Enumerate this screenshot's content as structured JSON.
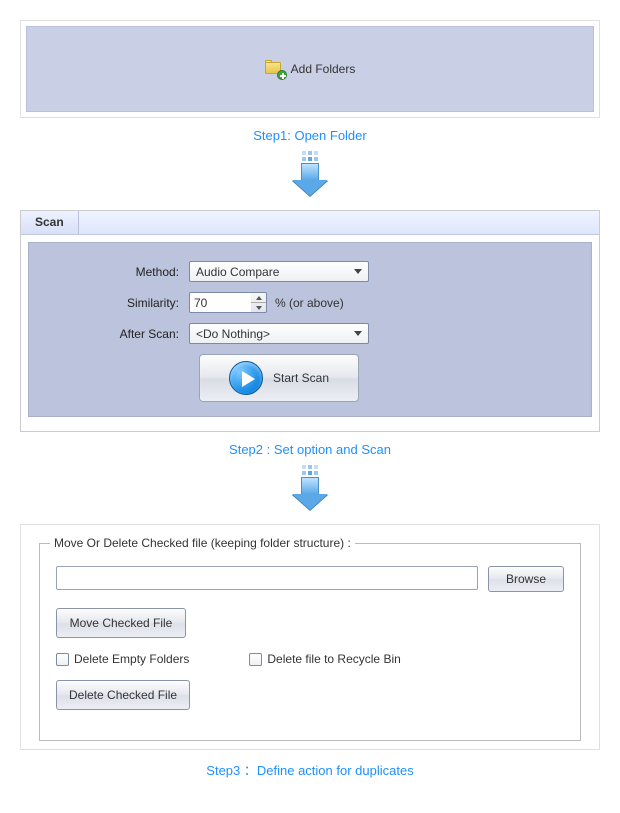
{
  "step1": {
    "add_folders_label": "Add Folders",
    "caption": "Step1: Open Folder"
  },
  "step2": {
    "tab_label": "Scan",
    "method_label": "Method:",
    "method_value": "Audio Compare",
    "similarity_label": "Similarity:",
    "similarity_value": "70",
    "similarity_suffix": "% (or above)",
    "after_scan_label": "After Scan:",
    "after_scan_value": "<Do Nothing>",
    "start_scan_label": "Start Scan",
    "caption": "Step2 : Set option and Scan"
  },
  "step3": {
    "group_title": "Move Or Delete Checked file (keeping folder structure) :",
    "path_value": "",
    "browse_label": "Browse",
    "move_btn_label": "Move Checked File",
    "delete_empty_label": "Delete Empty Folders",
    "recycle_label": "Delete file to Recycle Bin",
    "delete_btn_label": "Delete Checked File",
    "caption": "Step3 ：Define action for duplicates"
  }
}
